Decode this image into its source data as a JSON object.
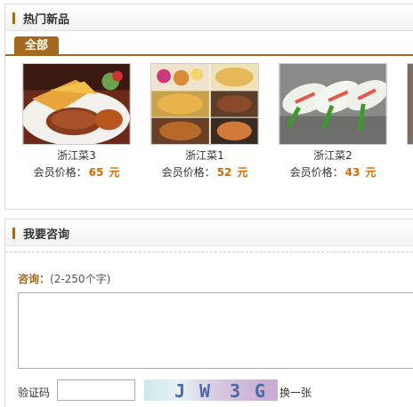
{
  "new_products": {
    "title": "热门新品",
    "tab_all": "全部",
    "price_label": "会员价格：",
    "currency": "元",
    "items": [
      {
        "name": "浙江菜3",
        "price": "65"
      },
      {
        "name": "浙江菜1",
        "price": "52"
      },
      {
        "name": "浙江菜2",
        "price": "43"
      }
    ]
  },
  "consult": {
    "title": "我要咨询",
    "label": "咨询：",
    "hint": "(2-250个字)",
    "captcha_label": "验证码",
    "captcha_chars": [
      "J",
      "W",
      "3",
      "G"
    ],
    "captcha_refresh": "换一张"
  },
  "colors": {
    "accent": "#a36a1f",
    "price": "#d96a00"
  }
}
